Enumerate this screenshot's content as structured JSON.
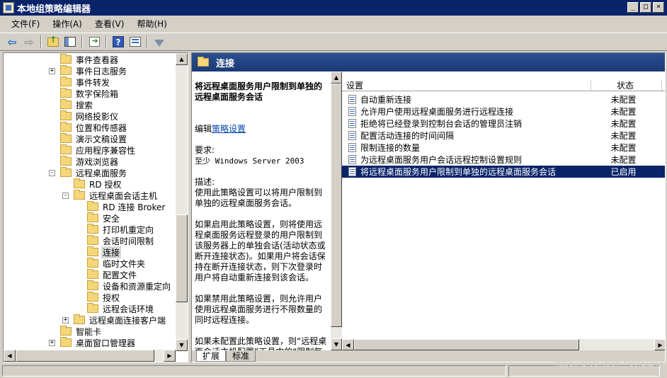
{
  "window": {
    "title": "本地组策略编辑器",
    "buttons": {
      "minimize": "_",
      "maximize": "□",
      "close": "×"
    }
  },
  "menu": [
    {
      "label": "文件(F)"
    },
    {
      "label": "操作(A)"
    },
    {
      "label": "查看(V)"
    },
    {
      "label": "帮助(H)"
    }
  ],
  "toolbar": {
    "icons": [
      "back-arrow-icon",
      "forward-arrow-icon",
      "up-folder-icon",
      "show-hide-tree-icon",
      "export-list-icon",
      "help-icon",
      "properties-icon",
      "filter-icon"
    ]
  },
  "tree": [
    {
      "label": "事件查看器",
      "indent": 0,
      "expander": ""
    },
    {
      "label": "事件日志服务",
      "indent": 0,
      "expander": "+"
    },
    {
      "label": "事件转发",
      "indent": 0,
      "expander": ""
    },
    {
      "label": "数字保险箱",
      "indent": 0,
      "expander": ""
    },
    {
      "label": "搜索",
      "indent": 0,
      "expander": ""
    },
    {
      "label": "网络投影仪",
      "indent": 0,
      "expander": ""
    },
    {
      "label": "位置和传感器",
      "indent": 0,
      "expander": ""
    },
    {
      "label": "演示文稿设置",
      "indent": 0,
      "expander": ""
    },
    {
      "label": "应用程序兼容性",
      "indent": 0,
      "expander": ""
    },
    {
      "label": "游戏浏览器",
      "indent": 0,
      "expander": ""
    },
    {
      "label": "远程桌面服务",
      "indent": 0,
      "expander": "-"
    },
    {
      "label": "RD 授权",
      "indent": 1,
      "expander": ""
    },
    {
      "label": "远程桌面会话主机",
      "indent": 1,
      "expander": "-"
    },
    {
      "label": "RD 连接 Broker",
      "indent": 2,
      "expander": ""
    },
    {
      "label": "安全",
      "indent": 2,
      "expander": ""
    },
    {
      "label": "打印机重定向",
      "indent": 2,
      "expander": ""
    },
    {
      "label": "会话时间限制",
      "indent": 2,
      "expander": ""
    },
    {
      "label": "连接",
      "indent": 2,
      "expander": "",
      "selected": true
    },
    {
      "label": "临时文件夹",
      "indent": 2,
      "expander": ""
    },
    {
      "label": "配置文件",
      "indent": 2,
      "expander": ""
    },
    {
      "label": "设备和资源重定向",
      "indent": 2,
      "expander": ""
    },
    {
      "label": "授权",
      "indent": 2,
      "expander": ""
    },
    {
      "label": "远程会话环境",
      "indent": 2,
      "expander": ""
    },
    {
      "label": "远程桌面连接客户端",
      "indent": 1,
      "expander": "+"
    },
    {
      "label": "智能卡",
      "indent": 0,
      "expander": ""
    },
    {
      "label": "桌面窗口管理器",
      "indent": 0,
      "expander": "+"
    }
  ],
  "right": {
    "header_title": "连接",
    "description": {
      "title": "将远程桌面服务用户限制到单独的远程桌面服务会话",
      "edit_prefix": "编辑",
      "edit_link": "策略设置",
      "requirements_label": "要求:",
      "requirements_value": "至少 Windows Server 2003",
      "desc_label": "描述:",
      "desc_p1": "使用此策略设置可以将用户限制到单独的远程桌面服务会话。",
      "desc_p2": "如果启用此策略设置，则将使用远程桌面服务远程登录的用户限制到该服务器上的单独会话(活动状态或断开连接状态)。如果用户将会话保持在断开连接状态，则下次登录时用户将自动重新连接到该会话。",
      "desc_p3": "如果禁用此策略设置，则允许用户使用远程桌面服务进行不限数量的同时远程连接。",
      "desc_p4": "如果未配置此策略设置，则“远程桌面会话主机配置”工具中的“限制每个用户一个会话”设置将确定是否将用户限制到单独的远程桌面"
    },
    "columns": {
      "setting": "设置",
      "state": "状态"
    },
    "settings": [
      {
        "setting": "自动重新连接",
        "state": "未配置"
      },
      {
        "setting": "允许用户使用远程桌面服务进行远程连接",
        "state": "未配置"
      },
      {
        "setting": "拒绝将已经登录到控制台会话的管理员注销",
        "state": "未配置"
      },
      {
        "setting": "配置活动连接的时间间隔",
        "state": "未配置"
      },
      {
        "setting": "限制连接的数量",
        "state": "未配置"
      },
      {
        "setting": "为远程桌面服务用户会话远程控制设置规则",
        "state": "未配置"
      },
      {
        "setting": "将远程桌面服务用户限制到单独的远程桌面服务会话",
        "state": "已启用",
        "selected": true
      }
    ],
    "tabs": [
      {
        "label": "扩展",
        "active": true
      },
      {
        "label": "标准",
        "active": false
      }
    ]
  },
  "watermark": "https://blog.csdn.net/l1j2k3"
}
